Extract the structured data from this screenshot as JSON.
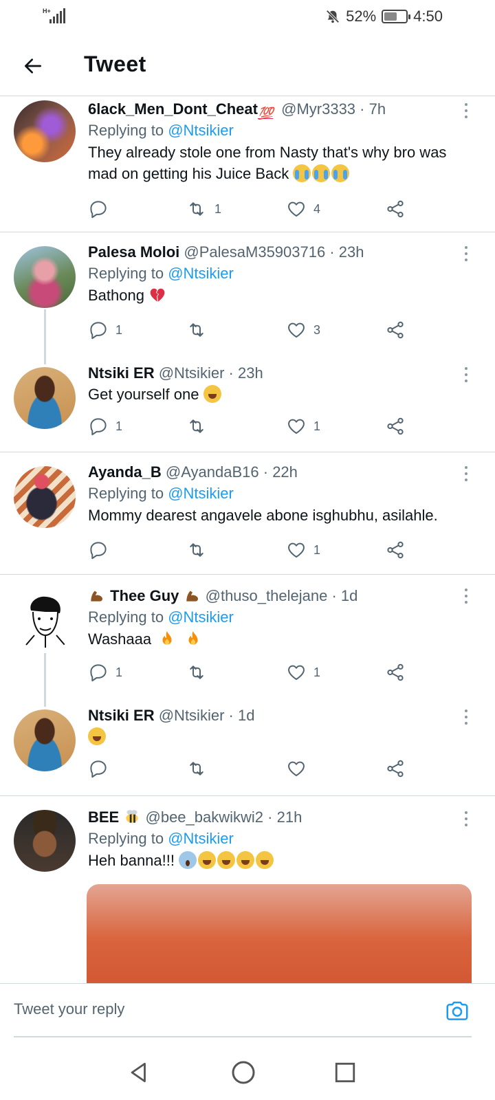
{
  "status_bar": {
    "network_type": "H+",
    "battery_percent": "52%",
    "time": "4:50",
    "battery_level": 0.52
  },
  "header": {
    "title": "Tweet"
  },
  "tweets": [
    {
      "name": "6lack_Men_Dont_Cheat",
      "handle": "@Myr3333",
      "time": "7h",
      "replying_label": "Replying to",
      "replying_to": "@Ntsikier",
      "text": "They already stole one from Nasty that's why bro was mad on getting his Juice Back",
      "reply_count": "",
      "retweet_count": "1",
      "like_count": "4"
    },
    {
      "name": "Palesa Moloi",
      "handle": "@PalesaM35903716",
      "time": "23h",
      "replying_label": "Replying to",
      "replying_to": "@Ntsikier",
      "text": "Bathong",
      "reply_count": "1",
      "retweet_count": "",
      "like_count": "3"
    },
    {
      "name": "Ntsiki ER",
      "handle": "@Ntsikier",
      "time": "23h",
      "text": "Get yourself one",
      "reply_count": "1",
      "retweet_count": "",
      "like_count": "1"
    },
    {
      "name": "Ayanda_B",
      "handle": "@AyandaB16",
      "time": "22h",
      "replying_label": "Replying to",
      "replying_to": "@Ntsikier",
      "text": "Mommy dearest angavele abone isghubhu, asilahle.",
      "reply_count": "",
      "retweet_count": "",
      "like_count": "1"
    },
    {
      "name": "Thee Guy",
      "handle": "@thuso_thelejane",
      "time": "1d",
      "replying_label": "Replying to",
      "replying_to": "@Ntsikier",
      "text": "Washaaa",
      "reply_count": "1",
      "retweet_count": "",
      "like_count": "1"
    },
    {
      "name": "Ntsiki ER",
      "handle": "@Ntsikier",
      "time": "1d",
      "text": "",
      "reply_count": "",
      "retweet_count": "",
      "like_count": ""
    },
    {
      "name": "BEE",
      "handle": "@bee_bakwikwi2",
      "time": "21h",
      "replying_label": "Replying to",
      "replying_to": "@Ntsikier",
      "text": "Heh banna!!!"
    }
  ],
  "icons": {
    "more": "more-vertical-icon",
    "reply": "reply-icon",
    "retweet": "retweet-icon",
    "like": "heart-icon",
    "share": "share-icon"
  },
  "reply_bar": {
    "placeholder": "Tweet your reply"
  },
  "colors": {
    "accent": "#1d9bf0",
    "text": "#0f1419",
    "secondary": "#536471",
    "divider": "#cfd9de"
  }
}
